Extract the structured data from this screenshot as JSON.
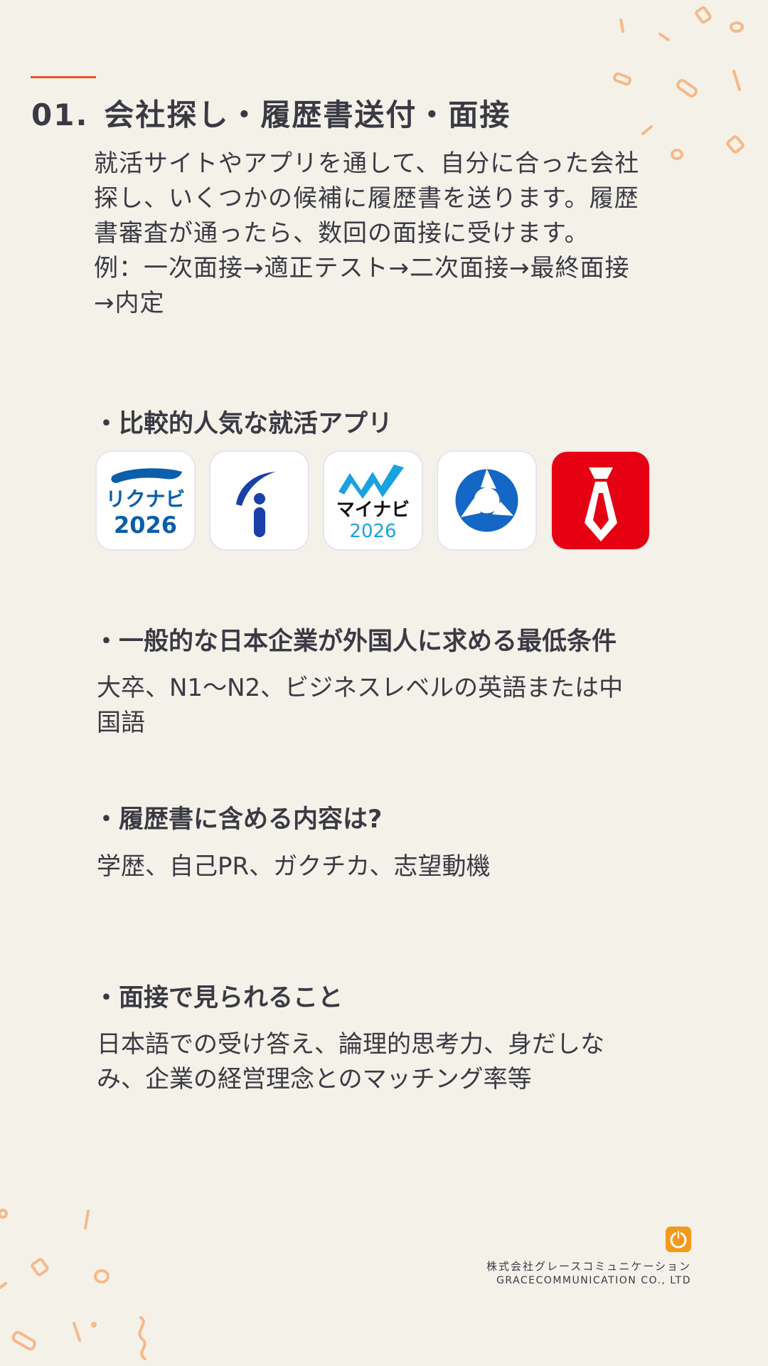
{
  "section": {
    "number": "01.",
    "title": "会社探し・履歴書送付・面接"
  },
  "intro": {
    "line1": "就活サイトやアプリを通して、自分に合った会社探し、いくつかの候補に履歴書を送ります。履歴書審査が通ったら、数回の面接に受けます。",
    "line2": "例：一次面接→適正テスト→二次面接→最終面接→内定"
  },
  "apps": {
    "heading": "比較的人気な就活アプリ",
    "items": [
      {
        "name": "rikunabi-icon",
        "text1": "リクナビ",
        "text2": "2026",
        "color": "#0b5eaa"
      },
      {
        "name": "indeed-icon",
        "color": "#1a3fa8"
      },
      {
        "name": "mynavi-icon",
        "text1": "マイナビ",
        "text2": "2026",
        "color": "#1aa1e0"
      },
      {
        "name": "onecareer-icon",
        "color": "#1467c4"
      },
      {
        "name": "tie-icon",
        "color": "#e50012"
      }
    ]
  },
  "requirements": {
    "heading": "一般的な日本企業が外国人に求める最低条件",
    "text": "大卒、N1〜N2、ビジネスレベルの英語または中国語"
  },
  "resume": {
    "heading": "履歴書に含める内容は?",
    "text": "学歴、自己PR、ガクチカ、志望動機"
  },
  "interview": {
    "heading": "面接で見られること",
    "text": "日本語での受け答え、論理的思考力、身だしなみ、企業の経営理念とのマッチング率等"
  },
  "footer": {
    "company_jp": "株式会社グレースコミュニケーション",
    "company_en": "GRACECOMMUNICATION CO., LTD"
  },
  "colors": {
    "background": "#f4f1e9",
    "accent": "#e0562b",
    "text": "#3a3a44",
    "confetti": "#f5b98a"
  }
}
